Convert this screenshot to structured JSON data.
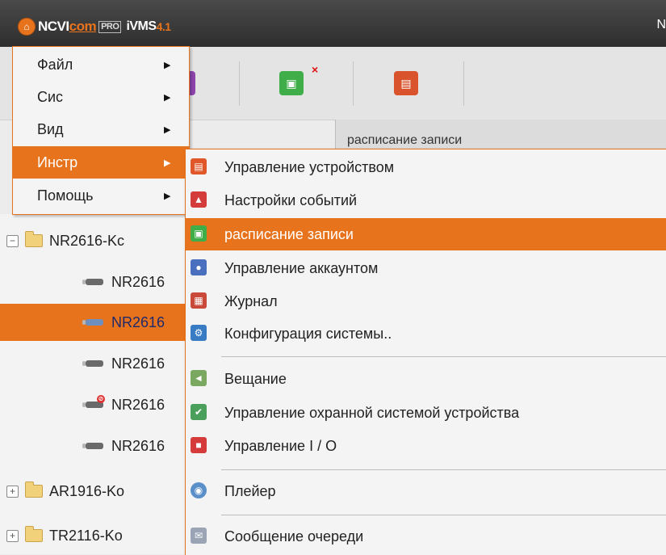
{
  "titlebar": {
    "brand_part1": "NCVI",
    "brand_part2": "com",
    "brand_badge": "PRO",
    "app_name": "iVMS",
    "version": "4.1",
    "right_text": "N"
  },
  "tab": {
    "label": "расписание записи"
  },
  "menu": {
    "items": [
      {
        "label": "Файл"
      },
      {
        "label": "Сис"
      },
      {
        "label": "Вид"
      },
      {
        "label": "Инстр"
      },
      {
        "label": "Помощь"
      }
    ],
    "active_index": 3
  },
  "submenu": {
    "items": [
      {
        "label": "Управление устройством",
        "icon": "device-management-icon"
      },
      {
        "label": "Настройки событий",
        "icon": "event-settings-icon"
      },
      {
        "label": "расписание записи",
        "icon": "record-schedule-icon"
      },
      {
        "label": "Управление аккаунтом",
        "icon": "account-management-icon"
      },
      {
        "label": "Журнал",
        "icon": "log-icon"
      },
      {
        "label": "Конфигурация системы..",
        "icon": "system-config-icon"
      },
      {
        "label": "Вещание",
        "icon": "broadcast-icon"
      },
      {
        "label": "Управление охранной системой устройства",
        "icon": "alarm-shield-icon"
      },
      {
        "label": "Управление I / O",
        "icon": "io-control-icon"
      },
      {
        "label": "Плейер",
        "icon": "player-icon"
      },
      {
        "label": "Сообщение очереди",
        "icon": "message-queue-icon"
      }
    ],
    "active_index": 2
  },
  "tree": {
    "rows": [
      {
        "label": "NR2616-Kc",
        "type": "folder",
        "expander": "−"
      },
      {
        "label": "NR2616",
        "type": "camera"
      },
      {
        "label": "NR2616",
        "type": "camera",
        "selected": true
      },
      {
        "label": "NR2616",
        "type": "camera"
      },
      {
        "label": "NR2616",
        "type": "camera",
        "error": true
      },
      {
        "label": "NR2616",
        "type": "camera"
      },
      {
        "label": "AR1916-Ko",
        "type": "folder",
        "expander": "+"
      },
      {
        "label": "TR2116-Ko",
        "type": "folder",
        "expander": "+"
      }
    ]
  },
  "colors": {
    "accent": "#e8731d",
    "titlebar": "#3a3a3a",
    "menu_bg": "#f4f4f4"
  }
}
